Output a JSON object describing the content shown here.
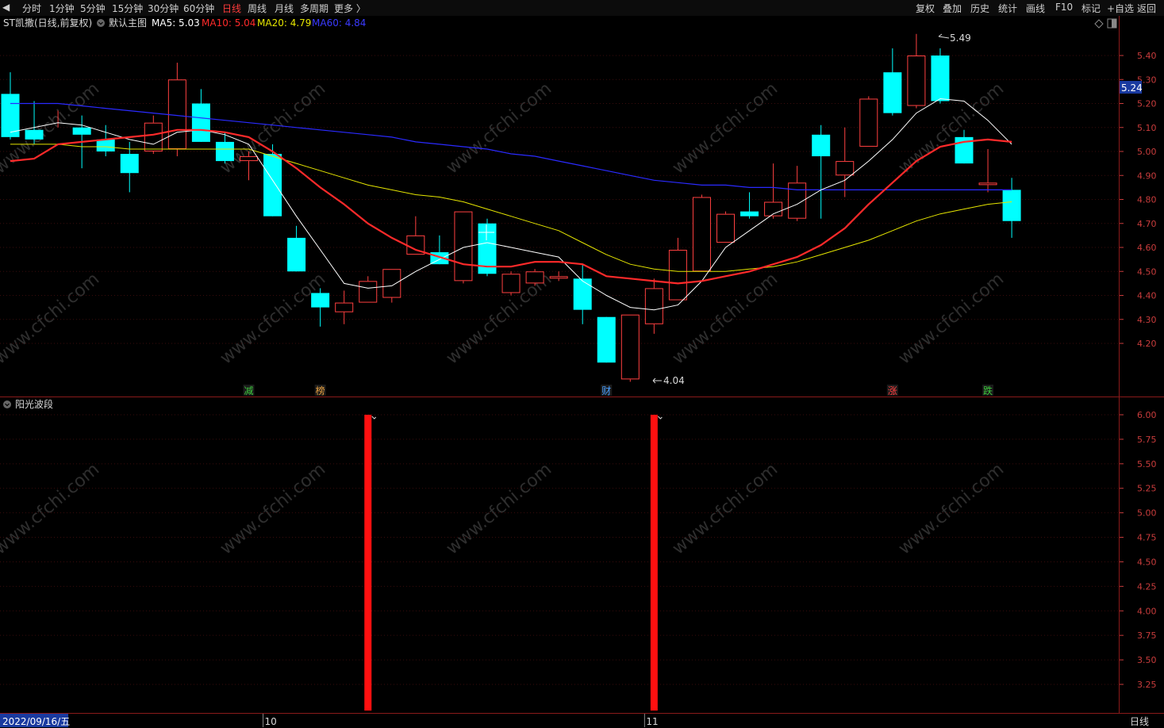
{
  "toolbar": {
    "left_items": [
      "◀",
      "分时",
      "1分钟",
      "5分钟",
      "15分钟",
      "30分钟",
      "60分钟",
      "日线",
      "周线",
      "月线",
      "多周期",
      "更多 〉"
    ],
    "active": "日线",
    "right_items": [
      "复权",
      "叠加",
      "历史",
      "统计",
      "画线",
      "F10",
      "标记",
      "+自选",
      "返回"
    ]
  },
  "main_panel": {
    "stock_title": "ST凯撒(日线,前复权)",
    "template_label": "默认主图",
    "ma5": {
      "label": "MA5: 5.03",
      "color": "#ffffff"
    },
    "ma10": {
      "label": "MA10: 5.04",
      "color": "#ff2a2a"
    },
    "ma20": {
      "label": "MA20: 4.79",
      "color": "#e6e600"
    },
    "ma60": {
      "label": "MA60: 4.84",
      "color": "#2a2aff"
    },
    "current_price_tag": "5.24",
    "high_label": "5.49",
    "low_label": "4.04",
    "event_markers": [
      {
        "text": "减",
        "color": "#3cc83c",
        "index": 10
      },
      {
        "text": "榜",
        "color": "#e6a040",
        "index": 13
      },
      {
        "text": "财",
        "color": "#4aa0ff",
        "index": 25
      },
      {
        "text": "涨",
        "color": "#ff4040",
        "index": 37
      },
      {
        "text": "跌",
        "color": "#3cc83c",
        "index": 41
      }
    ]
  },
  "sub_panel": {
    "title": "阳光波段",
    "ticks": [
      "6.00",
      "5.75",
      "5.50",
      "5.25",
      "5.00",
      "4.75",
      "4.50",
      "4.25",
      "4.00",
      "3.75",
      "3.50",
      "3.25"
    ]
  },
  "bottom_bar": {
    "date_label": "2022/09/16/五",
    "month_labels": [
      {
        "text": "10",
        "index": 11
      },
      {
        "text": "11",
        "index": 27
      }
    ],
    "period_label": "日线"
  },
  "watermark": "www.cfchi.com",
  "colors": {
    "up": "#ff4040",
    "down": "#00ffff",
    "grid": "#5a1010",
    "axis": "#c83c3c"
  },
  "chart_data": {
    "type": "candlestick",
    "price_axis": {
      "ticks": [
        5.4,
        5.3,
        5.2,
        5.1,
        5.0,
        4.9,
        4.8,
        4.7,
        4.6,
        4.5,
        4.4,
        4.3,
        4.2
      ],
      "ylim": [
        4.04,
        5.53
      ]
    },
    "candles": [
      {
        "o": 5.24,
        "h": 5.33,
        "l": 5.05,
        "c": 5.06
      },
      {
        "o": 5.09,
        "h": 5.21,
        "l": 5.03,
        "c": 5.05
      },
      {
        "o": 5.15,
        "h": 5.17,
        "l": 5.1,
        "c": 5.15
      },
      {
        "o": 5.1,
        "h": 5.15,
        "l": 4.93,
        "c": 5.07
      },
      {
        "o": 5.05,
        "h": 5.11,
        "l": 4.98,
        "c": 5.0
      },
      {
        "o": 4.99,
        "h": 5.04,
        "l": 4.83,
        "c": 4.91
      },
      {
        "o": 5.0,
        "h": 5.15,
        "l": 4.99,
        "c": 5.12
      },
      {
        "o": 5.01,
        "h": 5.37,
        "l": 4.98,
        "c": 5.3
      },
      {
        "o": 5.2,
        "h": 5.26,
        "l": 5.04,
        "c": 5.04
      },
      {
        "o": 5.04,
        "h": 5.08,
        "l": 4.95,
        "c": 4.96
      },
      {
        "o": 4.96,
        "h": 5.0,
        "l": 4.88,
        "c": 4.98
      },
      {
        "o": 4.99,
        "h": 5.03,
        "l": 4.73,
        "c": 4.73
      },
      {
        "o": 4.64,
        "h": 4.69,
        "l": 4.5,
        "c": 4.5
      },
      {
        "o": 4.41,
        "h": 4.43,
        "l": 4.27,
        "c": 4.35
      },
      {
        "o": 4.33,
        "h": 4.42,
        "l": 4.28,
        "c": 4.37
      },
      {
        "o": 4.37,
        "h": 4.48,
        "l": 4.37,
        "c": 4.46
      },
      {
        "o": 4.39,
        "h": 4.51,
        "l": 4.37,
        "c": 4.51
      },
      {
        "o": 4.57,
        "h": 4.73,
        "l": 4.57,
        "c": 4.65
      },
      {
        "o": 4.58,
        "h": 4.65,
        "l": 4.53,
        "c": 4.53
      },
      {
        "o": 4.46,
        "h": 4.75,
        "l": 4.45,
        "c": 4.75
      },
      {
        "o": 4.7,
        "h": 4.72,
        "l": 4.48,
        "c": 4.49
      },
      {
        "o": 4.41,
        "h": 4.5,
        "l": 4.4,
        "c": 4.49
      },
      {
        "o": 4.45,
        "h": 4.51,
        "l": 4.44,
        "c": 4.5
      },
      {
        "o": 4.47,
        "h": 4.5,
        "l": 4.46,
        "c": 4.48
      },
      {
        "o": 4.47,
        "h": 4.53,
        "l": 4.28,
        "c": 4.34
      },
      {
        "o": 4.31,
        "h": 4.31,
        "l": 4.12,
        "c": 4.12
      },
      {
        "o": 4.05,
        "h": 4.32,
        "l": 4.04,
        "c": 4.32
      },
      {
        "o": 4.28,
        "h": 4.47,
        "l": 4.24,
        "c": 4.43
      },
      {
        "o": 4.38,
        "h": 4.64,
        "l": 4.38,
        "c": 4.59
      },
      {
        "o": 4.5,
        "h": 4.82,
        "l": 4.5,
        "c": 4.81
      },
      {
        "o": 4.62,
        "h": 4.75,
        "l": 4.62,
        "c": 4.74
      },
      {
        "o": 4.75,
        "h": 4.83,
        "l": 4.72,
        "c": 4.73
      },
      {
        "o": 4.73,
        "h": 4.95,
        "l": 4.72,
        "c": 4.79
      },
      {
        "o": 4.72,
        "h": 4.94,
        "l": 4.71,
        "c": 4.87
      },
      {
        "o": 5.07,
        "h": 5.11,
        "l": 4.72,
        "c": 4.98
      },
      {
        "o": 4.9,
        "h": 5.1,
        "l": 4.81,
        "c": 4.96
      },
      {
        "o": 5.02,
        "h": 5.23,
        "l": 5.02,
        "c": 5.22
      },
      {
        "o": 5.33,
        "h": 5.43,
        "l": 5.15,
        "c": 5.16
      },
      {
        "o": 5.19,
        "h": 5.49,
        "l": 5.18,
        "c": 5.4
      },
      {
        "o": 5.4,
        "h": 5.43,
        "l": 5.2,
        "c": 5.21
      },
      {
        "o": 5.06,
        "h": 5.09,
        "l": 4.95,
        "c": 4.95
      },
      {
        "o": 4.86,
        "h": 5.01,
        "l": 4.83,
        "c": 4.87
      },
      {
        "o": 4.84,
        "h": 4.89,
        "l": 4.64,
        "c": 4.71
      }
    ],
    "ma5": [
      5.08,
      5.1,
      5.12,
      5.11,
      5.08,
      5.05,
      5.03,
      5.08,
      5.09,
      5.07,
      5.03,
      4.88,
      4.73,
      4.59,
      4.45,
      4.43,
      4.44,
      4.5,
      4.55,
      4.6,
      4.62,
      4.6,
      4.58,
      4.56,
      4.46,
      4.4,
      4.35,
      4.34,
      4.36,
      4.46,
      4.6,
      4.67,
      4.74,
      4.78,
      4.84,
      4.88,
      4.96,
      5.05,
      5.16,
      5.22,
      5.21,
      5.13,
      5.03
    ],
    "ma10": [
      4.96,
      4.97,
      5.03,
      5.04,
      5.05,
      5.06,
      5.07,
      5.09,
      5.09,
      5.08,
      5.06,
      5.0,
      4.93,
      4.85,
      4.78,
      4.7,
      4.64,
      4.59,
      4.56,
      4.53,
      4.52,
      4.52,
      4.54,
      4.54,
      4.53,
      4.48,
      4.47,
      4.46,
      4.45,
      4.46,
      4.48,
      4.5,
      4.53,
      4.56,
      4.61,
      4.68,
      4.78,
      4.87,
      4.96,
      5.02,
      5.04,
      5.05,
      5.04
    ],
    "ma20": [
      5.03,
      5.03,
      5.03,
      5.02,
      5.02,
      5.01,
      5.01,
      5.01,
      5.01,
      5.01,
      5.01,
      4.98,
      4.95,
      4.92,
      4.89,
      4.86,
      4.84,
      4.82,
      4.81,
      4.79,
      4.76,
      4.73,
      4.7,
      4.67,
      4.62,
      4.57,
      4.53,
      4.51,
      4.5,
      4.5,
      4.5,
      4.51,
      4.52,
      4.54,
      4.57,
      4.6,
      4.63,
      4.67,
      4.71,
      4.74,
      4.76,
      4.78,
      4.79
    ],
    "ma60": [
      5.2,
      5.2,
      5.2,
      5.19,
      5.18,
      5.17,
      5.16,
      5.15,
      5.14,
      5.13,
      5.12,
      5.11,
      5.1,
      5.09,
      5.08,
      5.07,
      5.06,
      5.04,
      5.03,
      5.02,
      5.01,
      4.99,
      4.98,
      4.96,
      4.94,
      4.92,
      4.9,
      4.88,
      4.87,
      4.86,
      4.86,
      4.85,
      4.85,
      4.84,
      4.84,
      4.84,
      4.84,
      4.84,
      4.84,
      4.84,
      4.84,
      4.84,
      4.84
    ],
    "indicator_bars": [
      {
        "index": 15,
        "value": 6.0
      },
      {
        "index": 27,
        "value": 6.0
      }
    ],
    "indicator_ylim": [
      3.0,
      6.0
    ]
  }
}
